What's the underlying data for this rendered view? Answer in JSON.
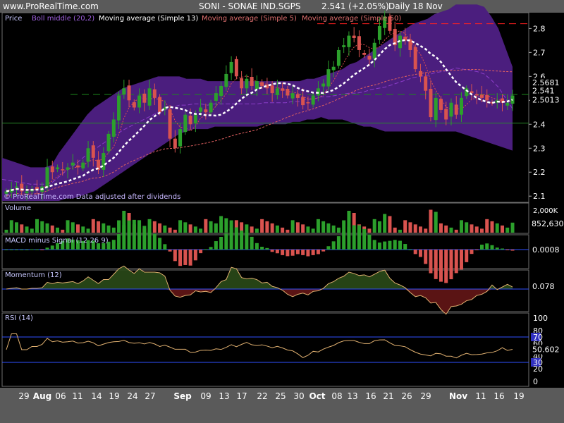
{
  "header": {
    "site": "www.ProRealTime.com",
    "symbol": "SONI - SONAE IND.SGPS",
    "quote": "2.541 (+2.05%)",
    "period": "Daily  18 Nov"
  },
  "colors": {
    "up": "#2ca02c",
    "down": "#d9534f",
    "band": "#4b1e7e",
    "sma13": "#ffffff",
    "sma5": "#e05050",
    "sma50": "#e06060",
    "boll_mid": "#8a3cc8",
    "grid_green": "#2a8a2a",
    "level_red": "#ff2020",
    "level_green": "#1c8a1c"
  },
  "chart_data": [
    {
      "type": "candlestick",
      "panel": "price",
      "legend": [
        "Price",
        "Boll middle (20,2)",
        "Moving average (Simple 13)",
        "Moving average (Simple 5)",
        "Moving average (Simple 50)"
      ],
      "annotation": "© ProRealTime.com  Data adjusted after dividends",
      "y_ticks": [
        "2.8",
        "2.7",
        "2.6",
        "2.5",
        "2.4",
        "2.3",
        "2.2",
        "2.1"
      ],
      "ylim": [
        2.08,
        2.86
      ],
      "price_labels": {
        "upper": "2.5681",
        "last": "2.541",
        "lower": "2.5013"
      },
      "horizontal_levels": [
        {
          "value": 2.82,
          "style": "dashed-red"
        },
        {
          "value": 2.525,
          "style": "dashed-green"
        },
        {
          "value": 2.405,
          "style": "solid-green"
        }
      ],
      "close": [
        2.12,
        2.13,
        2.14,
        2.12,
        2.12,
        2.13,
        2.13,
        2.14,
        2.22,
        2.2,
        2.22,
        2.21,
        2.22,
        2.24,
        2.22,
        2.24,
        2.3,
        2.26,
        2.21,
        2.28,
        2.36,
        2.42,
        2.52,
        2.55,
        2.5,
        2.47,
        2.52,
        2.49,
        2.55,
        2.51,
        2.45,
        2.47,
        2.34,
        2.3,
        2.38,
        2.44,
        2.4,
        2.44,
        2.47,
        2.45,
        2.49,
        2.53,
        2.56,
        2.61,
        2.66,
        2.6,
        2.55,
        2.59,
        2.56,
        2.58,
        2.56,
        2.55,
        2.53,
        2.55,
        2.54,
        2.52,
        2.53,
        2.51,
        2.48,
        2.49,
        2.52,
        2.55,
        2.57,
        2.63,
        2.64,
        2.71,
        2.73,
        2.77,
        2.76,
        2.71,
        2.69,
        2.67,
        2.74,
        2.81,
        2.85,
        2.79,
        2.73,
        2.77,
        2.75,
        2.71,
        2.63,
        2.6,
        2.54,
        2.43,
        2.51,
        2.46,
        2.42,
        2.49,
        2.44,
        2.51,
        2.55,
        2.53,
        2.52,
        2.51,
        2.5,
        2.49,
        2.5,
        2.49,
        2.49,
        2.52
      ],
      "bollinger_upper": [
        2.26,
        2.25,
        2.24,
        2.23,
        2.22,
        2.22,
        2.22,
        2.23,
        2.28,
        2.32,
        2.36,
        2.4,
        2.44,
        2.47,
        2.49,
        2.51,
        2.53,
        2.55,
        2.56,
        2.57,
        2.58,
        2.59,
        2.6,
        2.6,
        2.6,
        2.6,
        2.59,
        2.59,
        2.59,
        2.58,
        2.58,
        2.58,
        2.58,
        2.58,
        2.58,
        2.58,
        2.58,
        2.58,
        2.58,
        2.58,
        2.58,
        2.58,
        2.58,
        2.59,
        2.59,
        2.6,
        2.61,
        2.62,
        2.63,
        2.65,
        2.66,
        2.68,
        2.7,
        2.72,
        2.74,
        2.76,
        2.78,
        2.8,
        2.82,
        2.83,
        2.84,
        2.86,
        2.87,
        2.88,
        2.9,
        2.9,
        2.9,
        2.9,
        2.89,
        2.85,
        2.8,
        2.72,
        2.64
      ],
      "bollinger_lower": [
        2.08,
        2.08,
        2.08,
        2.08,
        2.08,
        2.08,
        2.08,
        2.08,
        2.08,
        2.09,
        2.09,
        2.1,
        2.11,
        2.12,
        2.14,
        2.16,
        2.18,
        2.2,
        2.22,
        2.24,
        2.26,
        2.28,
        2.3,
        2.32,
        2.34,
        2.36,
        2.37,
        2.38,
        2.38,
        2.38,
        2.39,
        2.39,
        2.39,
        2.39,
        2.39,
        2.39,
        2.39,
        2.4,
        2.4,
        2.4,
        2.4,
        2.41,
        2.41,
        2.42,
        2.42,
        2.43,
        2.42,
        2.42,
        2.42,
        2.41,
        2.4,
        2.39,
        2.39,
        2.38,
        2.37,
        2.37,
        2.37,
        2.37,
        2.37,
        2.37,
        2.37,
        2.37,
        2.37,
        2.37,
        2.37,
        2.36,
        2.35,
        2.34,
        2.33,
        2.32,
        2.31,
        2.3,
        2.29
      ]
    },
    {
      "type": "bar",
      "panel": "volume",
      "legend": [
        "Volume"
      ],
      "y_ticks": [
        "2,000K"
      ],
      "last_label": "852,630",
      "ylim": [
        0,
        2400000
      ]
    },
    {
      "type": "bar",
      "panel": "macd",
      "legend": [
        "MACD minus Signal (12 26 9)"
      ],
      "last_label": "0.0008"
    },
    {
      "type": "area",
      "panel": "momentum",
      "legend": [
        "Momentum (12)"
      ],
      "last_label": "0.078",
      "ylim": [
        -0.35,
        0.25
      ]
    },
    {
      "type": "line",
      "panel": "rsi",
      "legend": [
        "RSI (14)"
      ],
      "y_ticks": [
        "100",
        "80",
        "70",
        "60",
        "40",
        "30",
        "20",
        "0"
      ],
      "last_label": "50.602",
      "ylim": [
        0,
        100
      ],
      "levels": [
        70,
        30
      ]
    }
  ],
  "x_axis": {
    "labels": [
      "29",
      "Aug",
      "06",
      "11",
      "14",
      "19",
      "24",
      "27",
      "Sep",
      "09",
      "13",
      "17",
      "22",
      "25",
      "30",
      "Oct",
      "08",
      "13",
      "16",
      "21",
      "26",
      "29",
      "Nov",
      "11",
      "16",
      "19"
    ],
    "bold": [
      "Aug",
      "Sep",
      "Oct",
      "Nov"
    ]
  }
}
